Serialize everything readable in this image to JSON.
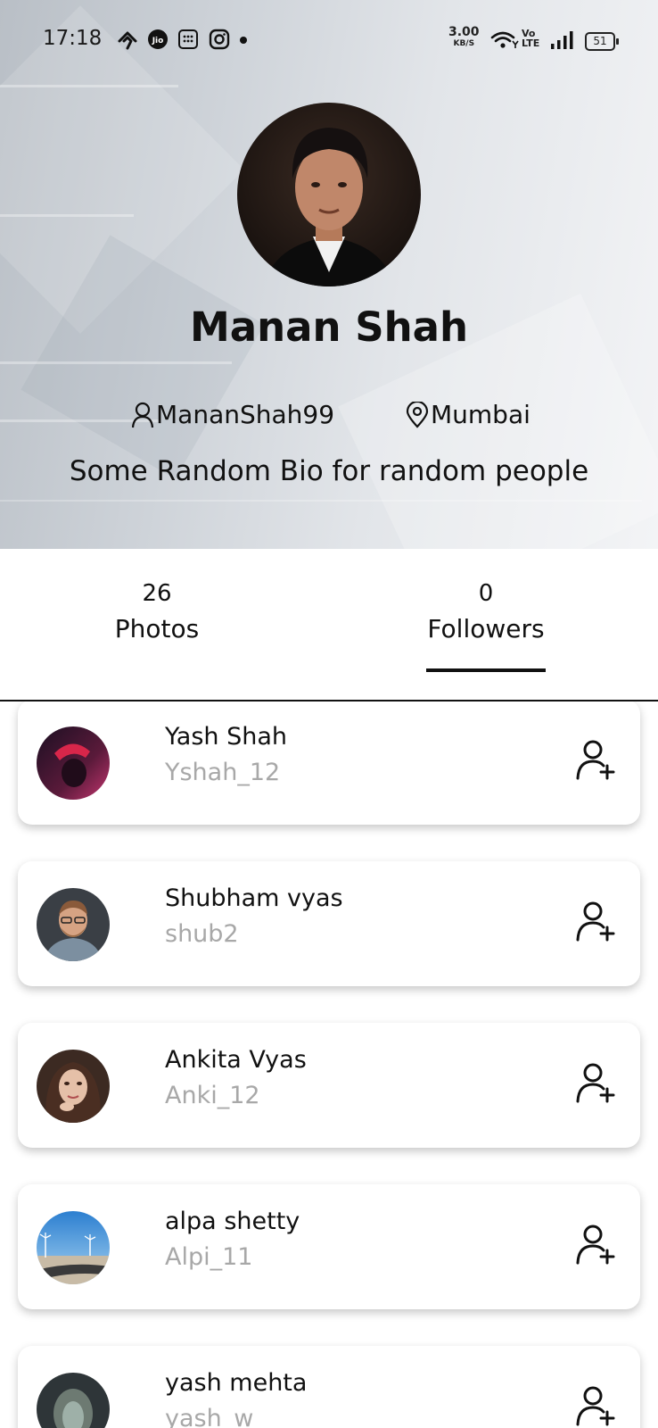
{
  "status_bar": {
    "time": "17:18",
    "network_speed": "3.00",
    "network_unit": "KB/S",
    "volte": "Vo",
    "lte": "LTE",
    "battery": "51"
  },
  "profile": {
    "name": "Manan Shah",
    "username": "MananShah99",
    "location": "Mumbai",
    "bio": "Some Random Bio for random people"
  },
  "stats": {
    "photos_count": "26",
    "photos_label": "Photos",
    "followers_count": "0",
    "followers_label": "Followers",
    "active_tab": "Followers"
  },
  "followers": [
    {
      "name": "Yash Shah",
      "username": "Yshah_12"
    },
    {
      "name": "Shubham vyas",
      "username": "shub2"
    },
    {
      "name": "Ankita Vyas",
      "username": "Anki_12"
    },
    {
      "name": "alpa shetty",
      "username": "Alpi_11"
    },
    {
      "name": "yash mehta",
      "username": "yash_w"
    }
  ],
  "icons": {
    "user": "person-outline-icon",
    "location": "location-pin-icon",
    "follow": "person-add-icon"
  },
  "colors": {
    "username_gray": "#a8a8a8",
    "text": "#111111"
  }
}
